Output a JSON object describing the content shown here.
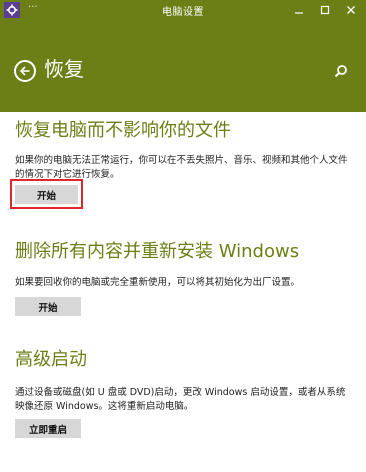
{
  "window": {
    "title": "电脑设置",
    "sysmenu": "···",
    "accent": "#6b7f16",
    "icons": {
      "app": "gear-icon",
      "minimize": "minimize-icon",
      "maximize": "maximize-icon",
      "close": "close-icon"
    }
  },
  "header": {
    "title": "恢复",
    "back_icon": "back-arrow-icon",
    "search_icon": "search-icon"
  },
  "sections": [
    {
      "heading": "恢复电脑而不影响你的文件",
      "description": "如果你的电脑无法正常运行，你可以在不丢失照片、音乐、视频和其他个人文件的情况下对它进行恢复。",
      "button": "开始"
    },
    {
      "heading": "删除所有内容并重新安装 Windows",
      "description": "如果要回收你的电脑或完全重新使用，可以将其初始化为出厂设置。",
      "button": "开始"
    },
    {
      "heading": "高级启动",
      "description": "通过设备或磁盘(如 U 盘或 DVD)启动，更改 Windows 启动设置，或者从系统映像还原 Windows。这将重新启动电脑。",
      "button": "立即重启"
    }
  ]
}
